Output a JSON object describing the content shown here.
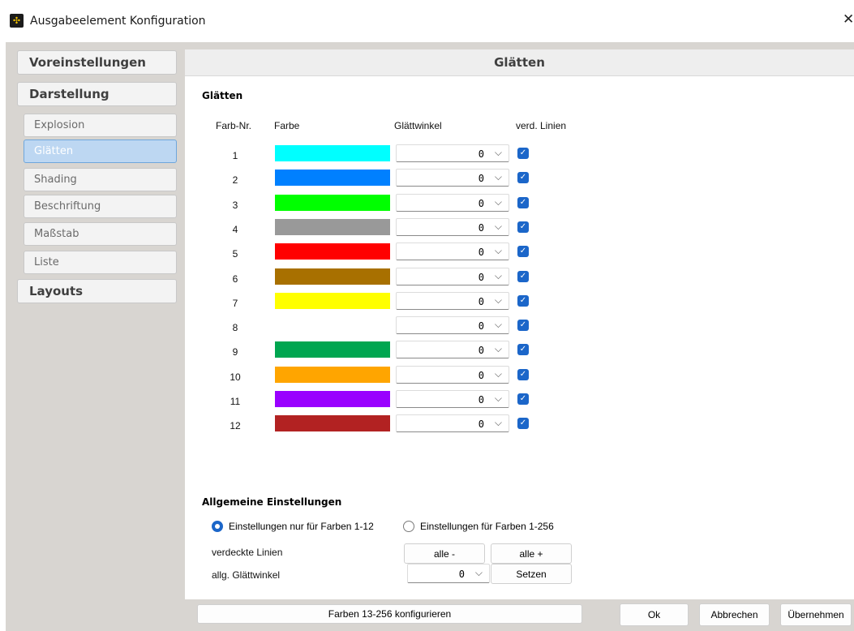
{
  "window": {
    "title": "Ausgabeelement Konfiguration",
    "close_glyph": "✕",
    "icon_name": "app-logo-icon",
    "icon_glyph": "✣"
  },
  "sidebar": {
    "items": [
      {
        "label": "Voreinstellungen",
        "level": "major"
      },
      {
        "label": "Darstellung",
        "level": "major"
      },
      {
        "label": "Explosion",
        "level": "minor"
      },
      {
        "label": "Glätten",
        "level": "minor",
        "active": true
      },
      {
        "label": "Shading",
        "level": "minor"
      },
      {
        "label": "Beschriftung",
        "level": "minor"
      },
      {
        "label": "Maßstab",
        "level": "minor"
      },
      {
        "label": "Liste",
        "level": "minor"
      },
      {
        "label": "Layouts",
        "level": "major"
      }
    ]
  },
  "panel": {
    "title": "Glätten",
    "section_title": "Glätten",
    "columns": {
      "num": "Farb-Nr.",
      "color": "Farbe",
      "angle": "Glättwinkel",
      "lines": "verd. Linien"
    },
    "rows": [
      {
        "num": "1",
        "color": "#00ffff",
        "angle": "0",
        "checked": true
      },
      {
        "num": "2",
        "color": "#0080ff",
        "angle": "0",
        "checked": true
      },
      {
        "num": "3",
        "color": "#00ff00",
        "angle": "0",
        "checked": true
      },
      {
        "num": "4",
        "color": "#999999",
        "angle": "0",
        "checked": true
      },
      {
        "num": "5",
        "color": "#ff0000",
        "angle": "0",
        "checked": true
      },
      {
        "num": "6",
        "color": "#a87000",
        "angle": "0",
        "checked": true
      },
      {
        "num": "7",
        "color": "#ffff00",
        "angle": "0",
        "checked": true
      },
      {
        "num": "8",
        "color": "#ffffff",
        "angle": "0",
        "checked": true
      },
      {
        "num": "9",
        "color": "#00a650",
        "angle": "0",
        "checked": true
      },
      {
        "num": "10",
        "color": "#ffa500",
        "angle": "0",
        "checked": true
      },
      {
        "num": "11",
        "color": "#9900ff",
        "angle": "0",
        "checked": true
      },
      {
        "num": "12",
        "color": "#b22222",
        "angle": "0",
        "checked": true
      }
    ],
    "general": {
      "title": "Allgemeine Einstellungen",
      "radio_1": "Einstellungen nur für Farben 1-12",
      "radio_2": "Einstellungen für Farben 1-256",
      "hidden_lines_label": "verdeckte Linien",
      "all_minus": "alle -",
      "all_plus": "alle +",
      "angle_label": "allg. Glättwinkel",
      "angle_value": "0",
      "set_button": "Setzen"
    },
    "configure_button": "Farben 13-256 konfigurieren"
  },
  "footer": {
    "ok": "Ok",
    "cancel": "Abbrechen",
    "apply": "Übernehmen"
  },
  "icons": {
    "chevron": "⌵",
    "check": "✓"
  }
}
